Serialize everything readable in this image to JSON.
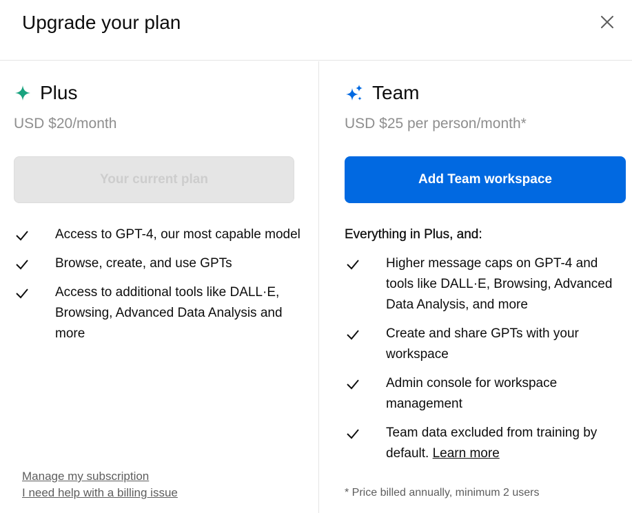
{
  "header": {
    "title": "Upgrade your plan"
  },
  "plans": {
    "plus": {
      "name": "Plus",
      "price": "USD $20/month",
      "button_label": "Your current plan",
      "features": [
        "Access to GPT-4, our most capable model",
        "Browse, create, and use GPTs",
        "Access to additional tools like DALL·E, Browsing, Advanced Data Analysis and more"
      ],
      "links": {
        "manage": "Manage my subscription",
        "billing_help": "I need help with a billing issue"
      }
    },
    "team": {
      "name": "Team",
      "price": "USD $25 per person/month*",
      "button_label": "Add Team workspace",
      "intro": "Everything in Plus, and:",
      "features": [
        "Higher message caps on GPT-4 and tools like DALL·E, Browsing, Advanced Data Analysis, and more",
        "Create and share GPTs with your workspace",
        "Admin console for workspace management",
        "Team data excluded from training by default."
      ],
      "learn_more": "Learn more",
      "footnote": "* Price billed annually, minimum 2 users"
    }
  },
  "icons": {
    "close": "close-icon",
    "plus_sparkle": "sparkle-icon",
    "team_sparkle": "sparkles-icon",
    "check": "check-icon"
  },
  "colors": {
    "plus_accent": "#19a37f",
    "team_accent": "#0169e1",
    "primary_button": "#0169e1",
    "disabled_button": "#e5e5e5"
  }
}
